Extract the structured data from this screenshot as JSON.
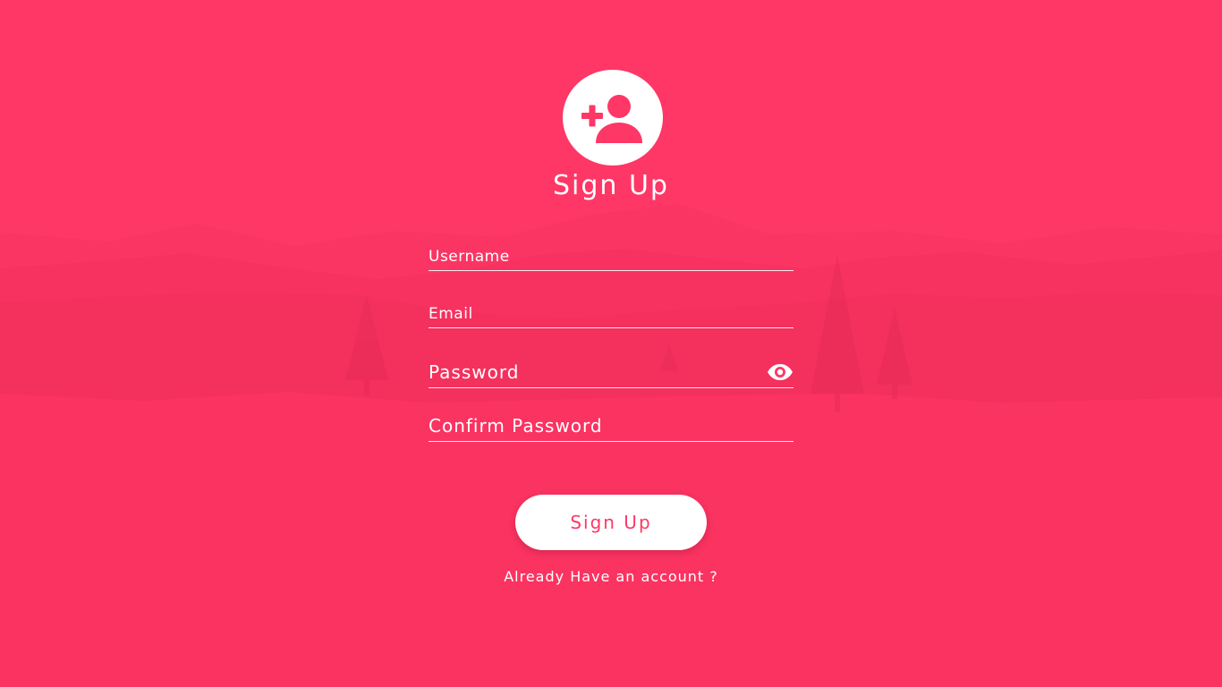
{
  "theme": {
    "background": "#fe3766",
    "accent": "#fe3766",
    "foreground": "#ffffff"
  },
  "header": {
    "icon": "add-user-icon",
    "title": "Sign Up"
  },
  "form": {
    "username": {
      "placeholder": "Username",
      "value": ""
    },
    "email": {
      "placeholder": "Email",
      "value": ""
    },
    "password": {
      "placeholder": "Password",
      "value": "",
      "toggle_icon": "eye-icon"
    },
    "confirm_password": {
      "placeholder": "Confirm Password",
      "value": ""
    },
    "submit_label": "Sign Up",
    "login_link": "Already Have an account ?"
  }
}
